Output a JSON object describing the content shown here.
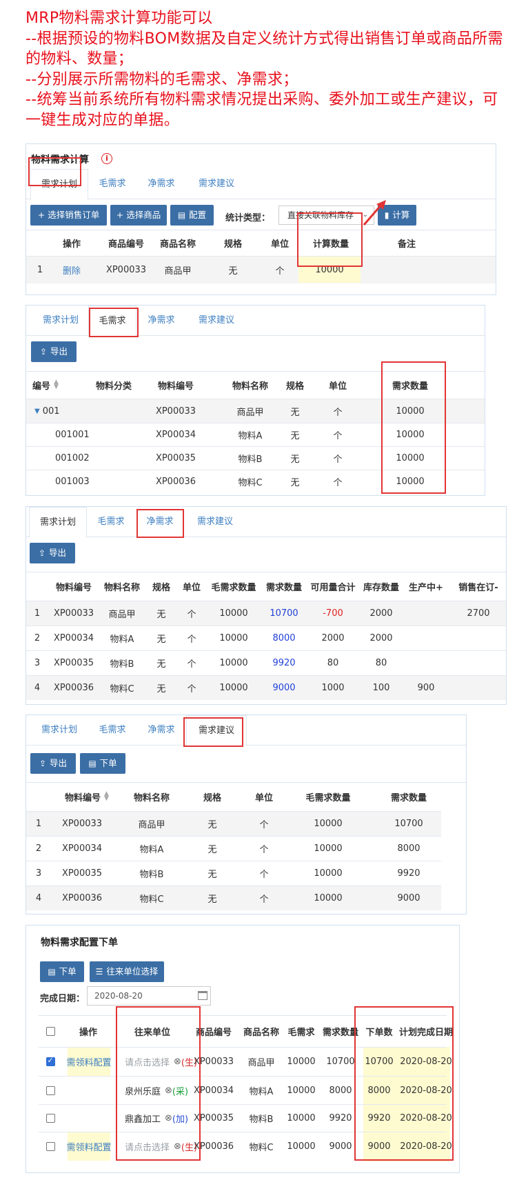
{
  "intro": [
    "MRP物料需求计算功能可以",
    "--根据预设的物料BOM数据及自定义统计方式得出销售订单或商品所需的物料、数量；",
    "--分别展示所需物料的毛需求、净需求；",
    "--统筹当前系统所有物料需求情况提出采购、委外加工或生产建议，可一键生成对应的单据。"
  ],
  "tabs": [
    "需求计划",
    "毛需求",
    "净需求",
    "需求建议"
  ],
  "p1": {
    "title": "物料需求计算",
    "info": "i",
    "buttons": [
      "+ 选择销售订单",
      "+ 选择商品",
      "配置"
    ],
    "calc_button": "计算",
    "stat_label": "统计类型：",
    "stat_value": "直接关联物料库存",
    "headers": [
      "操作",
      "商品编号",
      "商品名称",
      "规格",
      "单位",
      "计算数量",
      "备注"
    ],
    "row": [
      "1",
      "删除",
      "XP00033",
      "商品甲",
      "无",
      "个",
      "10000",
      ""
    ]
  },
  "p2": {
    "export": "导出",
    "headers": [
      "编号",
      "物料分类",
      "物料编号",
      "物料名称",
      "规格",
      "单位",
      "需求数量"
    ],
    "rows": [
      [
        "001",
        "",
        "XP00033",
        "商品甲",
        "无",
        "个",
        "10000"
      ],
      [
        "001001",
        "",
        "XP00034",
        "物料A",
        "无",
        "个",
        "10000"
      ],
      [
        "001002",
        "",
        "XP00035",
        "物料B",
        "无",
        "个",
        "10000"
      ],
      [
        "001003",
        "",
        "XP00036",
        "物料C",
        "无",
        "个",
        "10000"
      ]
    ]
  },
  "p3": {
    "export": "导出",
    "headers": [
      "物料编号",
      "物料名称",
      "规格",
      "单位",
      "毛需求数量",
      "需求数量",
      "可用量合计",
      "库存数量",
      "生产中+",
      "销售在订-"
    ],
    "rows": [
      [
        "1",
        "XP00033",
        "商品甲",
        "无",
        "个",
        "10000",
        "10700",
        "-700",
        "2000",
        "",
        "2700"
      ],
      [
        "2",
        "XP00034",
        "物料A",
        "无",
        "个",
        "10000",
        "8000",
        "2000",
        "2000",
        "",
        ""
      ],
      [
        "3",
        "XP00035",
        "物料B",
        "无",
        "个",
        "10000",
        "9920",
        "80",
        "80",
        "",
        ""
      ],
      [
        "4",
        "XP00036",
        "物料C",
        "无",
        "个",
        "10000",
        "9000",
        "1000",
        "100",
        "900",
        ""
      ]
    ]
  },
  "p4": {
    "export": "导出",
    "order": "下单",
    "headers": [
      "物料编号",
      "物料名称",
      "规格",
      "单位",
      "毛需求数量",
      "需求数量"
    ],
    "rows": [
      [
        "1",
        "XP00033",
        "商品甲",
        "无",
        "个",
        "10000",
        "10700"
      ],
      [
        "2",
        "XP00034",
        "物料A",
        "无",
        "个",
        "10000",
        "8000"
      ],
      [
        "3",
        "XP00035",
        "物料B",
        "无",
        "个",
        "10000",
        "9920"
      ],
      [
        "4",
        "XP00036",
        "物料C",
        "无",
        "个",
        "10000",
        "9000"
      ]
    ]
  },
  "p5": {
    "title": "物料需求配置下单",
    "order": "下单",
    "partner_select": "往来单位选择",
    "date_label": "完成日期：",
    "date_value": "2020-08-20",
    "headers": [
      "操作",
      "往来单位",
      "商品编号",
      "商品名称",
      "毛需求",
      "需求数量",
      "下单数",
      "计划完成日期"
    ],
    "rows": [
      {
        "checked": true,
        "op": "需领料配置",
        "unit": "请点击选择",
        "tag": "(生)",
        "code": "XP00033",
        "name": "商品甲",
        "gross": "10000",
        "need": "10700",
        "order": "10700",
        "date": "2020-08-20"
      },
      {
        "checked": false,
        "op": "",
        "unit": "泉州乐庭",
        "tag": "(采)",
        "code": "XP00034",
        "name": "物料A",
        "gross": "10000",
        "need": "8000",
        "order": "8000",
        "date": "2020-08-20"
      },
      {
        "checked": false,
        "op": "",
        "unit": "鼎鑫加工",
        "tag": "(加)",
        "code": "XP00035",
        "name": "物料B",
        "gross": "10000",
        "need": "9920",
        "order": "9920",
        "date": "2020-08-20"
      },
      {
        "checked": false,
        "op": "需领料配置",
        "unit": "请点击选择",
        "tag": "(生)",
        "code": "XP00036",
        "name": "物料C",
        "gross": "10000",
        "need": "9000",
        "order": "9000",
        "date": "2020-08-20"
      }
    ]
  }
}
